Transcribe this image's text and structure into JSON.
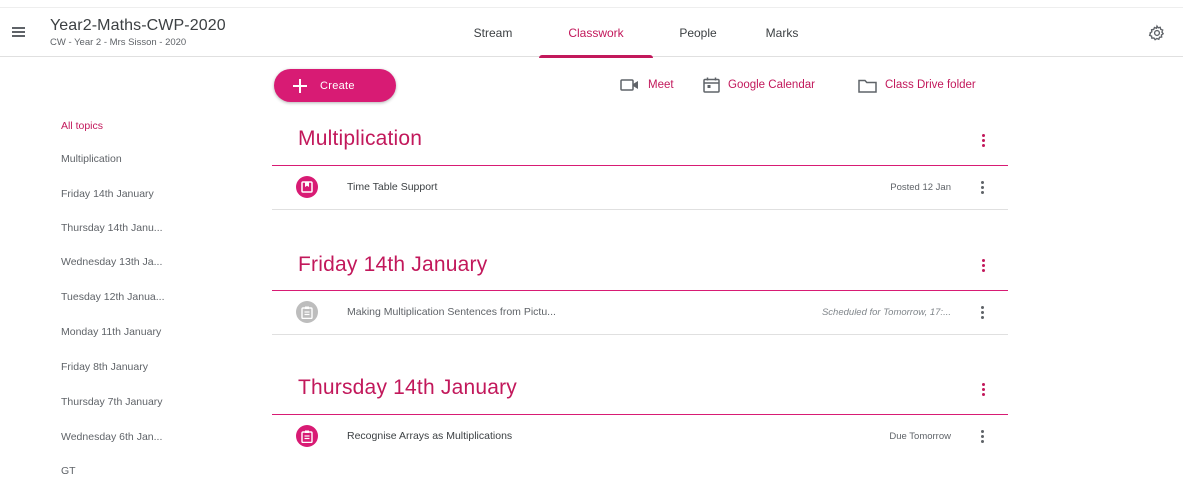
{
  "header": {
    "class_title": "Year2-Maths-CWP-2020",
    "class_subtitle": "CW - Year 2 - Mrs Sisson - 2020",
    "tabs": [
      {
        "label": "Stream",
        "active": false
      },
      {
        "label": "Classwork",
        "active": true
      },
      {
        "label": "People",
        "active": false
      },
      {
        "label": "Marks",
        "active": false
      }
    ],
    "icons": {
      "menu": "hamburger-menu-icon",
      "settings": "gear-icon"
    }
  },
  "toolbar": {
    "create_label": "Create",
    "meet_label": "Meet",
    "calendar_label": "Google Calendar",
    "drive_label": "Class Drive folder"
  },
  "topics": {
    "items": [
      "All topics",
      "Multiplication",
      "Friday 14th January",
      "Thursday 14th Janu...",
      "Wednesday 13th Ja...",
      "Tuesday 12th Janua...",
      "Monday 11th January",
      "Friday 8th January",
      "Thursday 7th January",
      "Wednesday 6th Jan...",
      "GT"
    ],
    "active_index": 0
  },
  "sections": [
    {
      "title": "Multiplication",
      "items": [
        {
          "title": "Time Table Support",
          "status": "Posted 12 Jan",
          "icon": "material-icon",
          "state": "posted"
        }
      ]
    },
    {
      "title": "Friday 14th January",
      "items": [
        {
          "title": "Making Multiplication Sentences from Pictu...",
          "status": "Scheduled for Tomorrow, 17:...",
          "icon": "assignment-icon",
          "state": "scheduled"
        }
      ]
    },
    {
      "title": "Thursday 14th January",
      "items": [
        {
          "title": "Recognise Arrays as Multiplications",
          "status": "Due Tomorrow",
          "icon": "assignment-icon",
          "state": "due"
        }
      ]
    }
  ],
  "colors": {
    "accent": "#c2185b",
    "create_button": "#d81b74",
    "scheduled_icon": "#bdbdbd"
  }
}
